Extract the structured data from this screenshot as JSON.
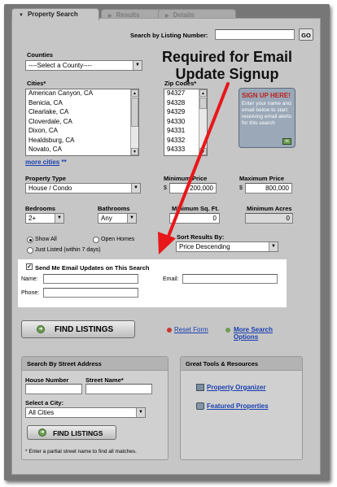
{
  "tabs": [
    {
      "label": "Property Search",
      "active": true
    },
    {
      "label": "Results",
      "active": false
    },
    {
      "label": "Details",
      "active": false
    }
  ],
  "listing_search": {
    "label": "Search by Listing Number:",
    "value": "",
    "go_label": "GO"
  },
  "counties": {
    "label": "Counties",
    "selected": "----Select a County----"
  },
  "cities": {
    "label": "Cities*",
    "items": [
      "American Canyon, CA",
      "Benicia, CA",
      "Clearlake, CA",
      "Cloverdale, CA",
      "Dixon, CA",
      "Healdsburg, CA",
      "Novato, CA"
    ],
    "more_link": "more cities",
    "more_stars": "**"
  },
  "zip_codes": {
    "label": "Zip Codes*",
    "items": [
      "94327",
      "94328",
      "94329",
      "94330",
      "94331",
      "94332",
      "94333"
    ]
  },
  "signup_box": {
    "title": "SIGN UP HERE!",
    "body": "Enter your name and email below to start receiving email alerts for this search"
  },
  "callout": {
    "line1": "Required for Email",
    "line2": "Update Signup"
  },
  "property_type": {
    "label": "Property Type",
    "selected": "House / Condo"
  },
  "min_price": {
    "label": "Minimum Price",
    "currency": "$",
    "value": "200,000"
  },
  "max_price": {
    "label": "Maximum Price",
    "currency": "$",
    "value": "800,000"
  },
  "bedrooms": {
    "label": "Bedrooms",
    "selected": "2+"
  },
  "bathrooms": {
    "label": "Bathrooms",
    "selected": "Any"
  },
  "min_sqft": {
    "label": "Minimum Sq. Ft.",
    "value": "0"
  },
  "min_acres": {
    "label": "Minimum Acres",
    "value": "0"
  },
  "show_options": {
    "show_all": "Show All",
    "open_homes": "Open Homes",
    "just_listed": "Just Listed (within 7 days)"
  },
  "sort": {
    "label": "Sort Results By:",
    "selected": "Price Descending"
  },
  "email_updates": {
    "checkbox_label": "Send Me Email Updates on This Search",
    "name_label": "Name:",
    "email_label": "Email:",
    "phone_label": "Phone:",
    "name_value": "",
    "email_value": "",
    "phone_value": ""
  },
  "find_listings": {
    "label": "FIND LISTINGS"
  },
  "reset_form": {
    "label": "Reset Form"
  },
  "more_search_options": {
    "line1": "More Search",
    "line2": "Options"
  },
  "street_search": {
    "title": "Search By Street Address",
    "house_number_label": "House Number",
    "street_name_label": "Street Name*",
    "house_number_value": "",
    "street_name_value": "",
    "city_label": "Select a City:",
    "city_selected": "All Cities",
    "button_label": "FIND LISTINGS",
    "footnote": "* Enter a partial street name to find all matches."
  },
  "tools": {
    "title": "Great Tools & Resources",
    "property_organizer": "Property Organizer",
    "featured_properties": "Featured Properties"
  },
  "colors": {
    "link": "#1a3fb1",
    "arrow": "#e8171a",
    "signup_red": "#c0201a",
    "go_green": "#6e9c52"
  }
}
